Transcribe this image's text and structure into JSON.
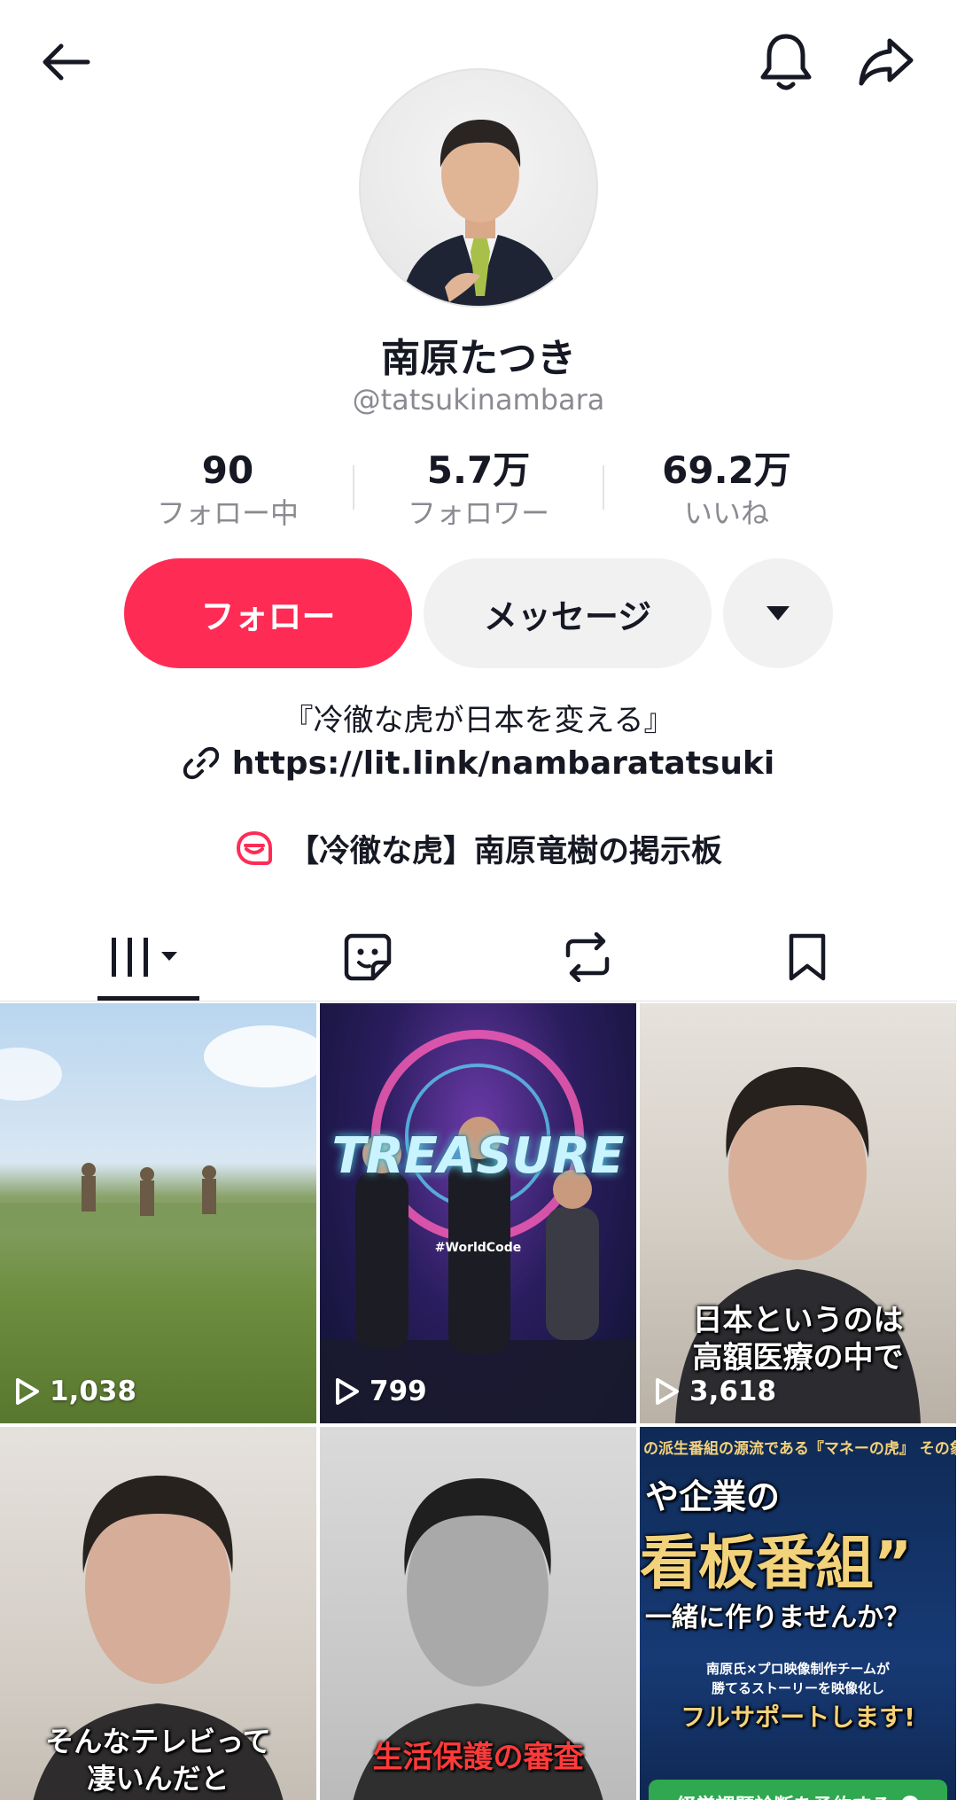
{
  "header": {
    "back_icon": "arrow-left-icon",
    "bell_icon": "bell-icon",
    "share_icon": "share-arrow-icon"
  },
  "profile": {
    "name": "南原たつき",
    "handle": "@tatsukinambara",
    "avatar": "avatar"
  },
  "stats": [
    {
      "value": "90",
      "label": "フォロー中"
    },
    {
      "value": "5.7万",
      "label": "フォロワー"
    },
    {
      "value": "69.2万",
      "label": "いいね"
    }
  ],
  "actions": {
    "follow_label": "フォロー",
    "message_label": "メッセージ",
    "more_icon": "caret-down-icon"
  },
  "bio": {
    "text": "『冷徹な虎が日本を変える』",
    "link": "https://lit.link/nambaratatsuki",
    "forum": "【冷徹な虎】南原竜樹の掲示板"
  },
  "tabs": [
    {
      "name": "videos",
      "icon": "grid-icon"
    },
    {
      "name": "stickers",
      "icon": "sticker-icon"
    },
    {
      "name": "reposts",
      "icon": "repost-icon"
    },
    {
      "name": "saved",
      "icon": "bookmark-icon"
    }
  ],
  "videos": [
    {
      "views": "1,038"
    },
    {
      "views": "799",
      "overlay": "TREASURE",
      "tag": "#WorldCode"
    },
    {
      "views": "3,618",
      "caption_1": "日本というのは",
      "caption_2": "高額医療の中で"
    },
    {
      "caption_1": "そんなテレビって",
      "caption_2": "凄いんだと"
    },
    {
      "caption_1": "生活保護の審査"
    },
    {
      "top": "の派生番組の源流である『マネーの虎』 その象徴的存在『レジェ",
      "line_1": "や企業の",
      "line_2": "看板番組”",
      "line_3": "一緒に作りませんか？",
      "line_4": "南原氏×プロ映像制作チームが",
      "line_5": "勝てるストーリーを映像化し",
      "line_6": "フルサポートします!",
      "button": "経営課題診断を予約する"
    }
  ],
  "colors": {
    "accent": "#fe2c55",
    "text": "#161823",
    "muted": "#8a8b91",
    "button_bg": "#f1f1f2"
  }
}
